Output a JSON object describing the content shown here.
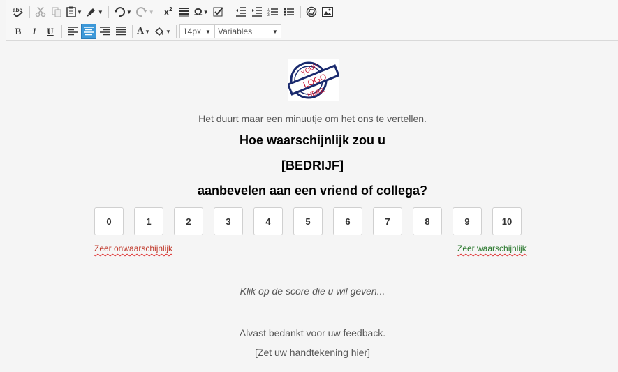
{
  "toolbar": {
    "row1": [
      "spellcheck-icon",
      "cut-icon",
      "copy-icon",
      "paste-icon",
      "format-painter-icon",
      "undo-icon",
      "redo-icon",
      "superscript-icon",
      "paragraph-icon",
      "special-char-icon",
      "checkbox-icon",
      "outdent-icon",
      "indent-icon",
      "ordered-list-icon",
      "unordered-list-icon",
      "link-icon",
      "image-icon"
    ],
    "bold_label": "B",
    "italic_label": "I",
    "underline_label": "U",
    "font_color_label": "A",
    "font_size": "14px",
    "variables": "Variables",
    "accent": "#3d98d8"
  },
  "content": {
    "logo_top": "YOUR",
    "logo_mid": "LOGO",
    "logo_bottom": "HERE",
    "intro": "Het duurt maar een minuutje om het ons te vertellen.",
    "question_line1": "Hoe waarschijnlijk zou u",
    "question_line2": "[BEDRIJF]",
    "question_line3": "aanbevelen aan een vriend of collega?",
    "scores": [
      "0",
      "1",
      "2",
      "3",
      "4",
      "5",
      "6",
      "7",
      "8",
      "9",
      "10"
    ],
    "label_low": "Zeer onwaarschijnlijk",
    "label_high": "Zeer waarschijnlijk",
    "hint": "Klik op de score die u wil geven...",
    "thanks": "Alvast bedankt voor uw feedback.",
    "signature": "[Zet uw handtekening hier]"
  }
}
